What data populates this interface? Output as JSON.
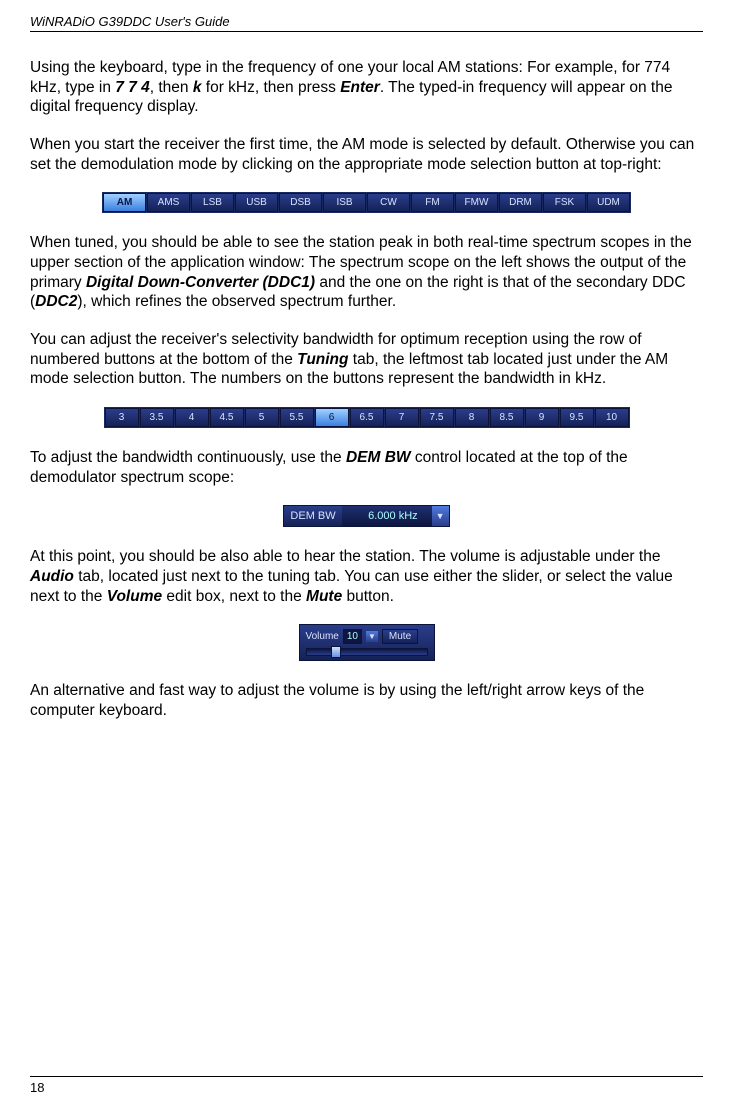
{
  "header": "WiNRADiO G39DDC User's Guide",
  "para1_a": "Using the keyboard, type in the frequency of one your local AM stations: For example, for 774 kHz, type in ",
  "para1_b": "7 7 4",
  "para1_c": ", then ",
  "para1_d": "k",
  "para1_e": " for kHz, then press ",
  "para1_f": "Enter",
  "para1_g": ". The typed-in frequency will appear on the digital frequency display.",
  "para2": "When you start the receiver the first time, the AM mode is selected by default. Otherwise you can set the demodulation mode by clicking on the appropriate mode selection button at top-right:",
  "modes": [
    "AM",
    "AMS",
    "LSB",
    "USB",
    "DSB",
    "ISB",
    "CW",
    "FM",
    "FMW",
    "DRM",
    "FSK",
    "UDM"
  ],
  "mode_selected_index": 0,
  "para3_a": "When tuned, you should be able to see the station peak in both real-time spectrum scopes in the upper section of the application window: The spectrum scope on the left shows the output of the primary ",
  "para3_b": "Digital Down-Converter (DDC1)",
  "para3_c": " and the one on the right is that of the secondary DDC (",
  "para3_d": "DDC2",
  "para3_e": "), which refines the observed spectrum further.",
  "para4_a": "You can adjust the receiver's selectivity bandwidth for optimum reception using the row of numbered buttons at the bottom of the ",
  "para4_b": "Tuning",
  "para4_c": " tab, the leftmost tab located just under the AM mode selection button. The numbers on the buttons represent the bandwidth in kHz.",
  "bandwidths": [
    "3",
    "3.5",
    "4",
    "4.5",
    "5",
    "5.5",
    "6",
    "6.5",
    "7",
    "7.5",
    "8",
    "8.5",
    "9",
    "9.5",
    "10"
  ],
  "bw_selected_index": 6,
  "para5_a": "To adjust the bandwidth continuously, use the ",
  "para5_b": "DEM BW",
  "para5_c": " control located at the top of the demodulator spectrum scope:",
  "dembw_label": "DEM BW",
  "dembw_value": "6.000 kHz",
  "para6_a": "At this point, you should be also able to hear the station. The volume is adjustable under the ",
  "para6_b": "Audio",
  "para6_c": " tab, located just next to the tuning tab. You can use either the slider, or select the value next to the ",
  "para6_d": "Volume",
  "para6_e": " edit box, next to the ",
  "para6_f": "Mute",
  "para6_g": " button.",
  "volume_label": "Volume",
  "volume_value": "10",
  "mute_label": "Mute",
  "para7": "An alternative and fast way to adjust the volume is by using the left/right arrow keys of the computer keyboard.",
  "page_number": "18"
}
